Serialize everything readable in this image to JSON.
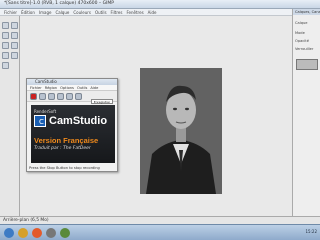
{
  "window": {
    "title": "*[Sans titre]-1.0 (RVB, 1 calque) 470x600 – GIMP"
  },
  "menubar": {
    "items": [
      "Fichier",
      "Édition",
      "Image",
      "Calque",
      "Couleurs",
      "Outils",
      "Filtres",
      "Fenêtres",
      "Aide"
    ]
  },
  "camstudio": {
    "title": "CamStudio",
    "menu": [
      "Fichier",
      "Région",
      "Options",
      "Outils",
      "Aide"
    ],
    "select_label": "Enregistrer vers MP4",
    "splash": {
      "publisher": "RenderSoft",
      "logo_mark": "C",
      "product": "CamStudio",
      "version": "Version Française",
      "translated": "Traduit par : The FatDeer"
    },
    "status": "Press the Stop Button to stop recording"
  },
  "right_panel": {
    "header": "Calques, Canaux, Chemins",
    "labels": [
      "Calque",
      "Mode",
      "Opacité",
      "Verrouiller"
    ]
  },
  "status_bar": {
    "text": "Arrière-plan (6,5 Mo)"
  },
  "taskbar": {
    "tray_time": "15:22"
  },
  "colors": {
    "accent": "#1a5fb4",
    "version_orange": "#f08a1c",
    "taskbar": "#8eaacb"
  }
}
